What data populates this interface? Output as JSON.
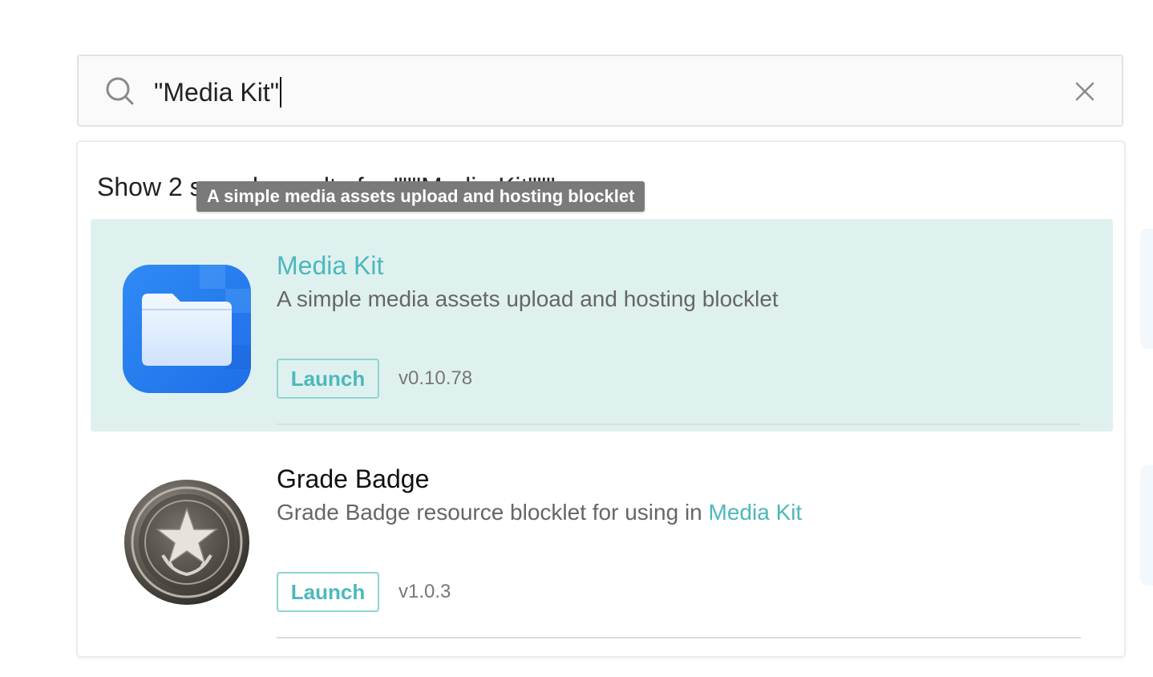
{
  "search": {
    "value": "\"Media Kit\"",
    "icon": "search-icon",
    "clear_icon": "close-icon"
  },
  "results": {
    "summary": "Show 2 search results for \"\"\"Media Kit\"\"\"",
    "tooltip": "A simple media assets upload and hosting blocklet",
    "items": [
      {
        "title": "Media Kit",
        "description": "A simple media assets upload and hosting blocklet",
        "launch_label": "Launch",
        "version": "v0.10.78",
        "logo": "folder-app-icon"
      },
      {
        "title": "Grade Badge",
        "description_prefix": "Grade Badge resource blocklet for using in ",
        "description_highlight": "Media Kit",
        "launch_label": "Launch",
        "version": "v1.0.3",
        "logo": "star-badge-icon"
      }
    ]
  },
  "colors": {
    "accent": "#4cb8bc",
    "highlight_bg": "#dff1ef",
    "tooltip_bg": "#7a7a7a"
  }
}
